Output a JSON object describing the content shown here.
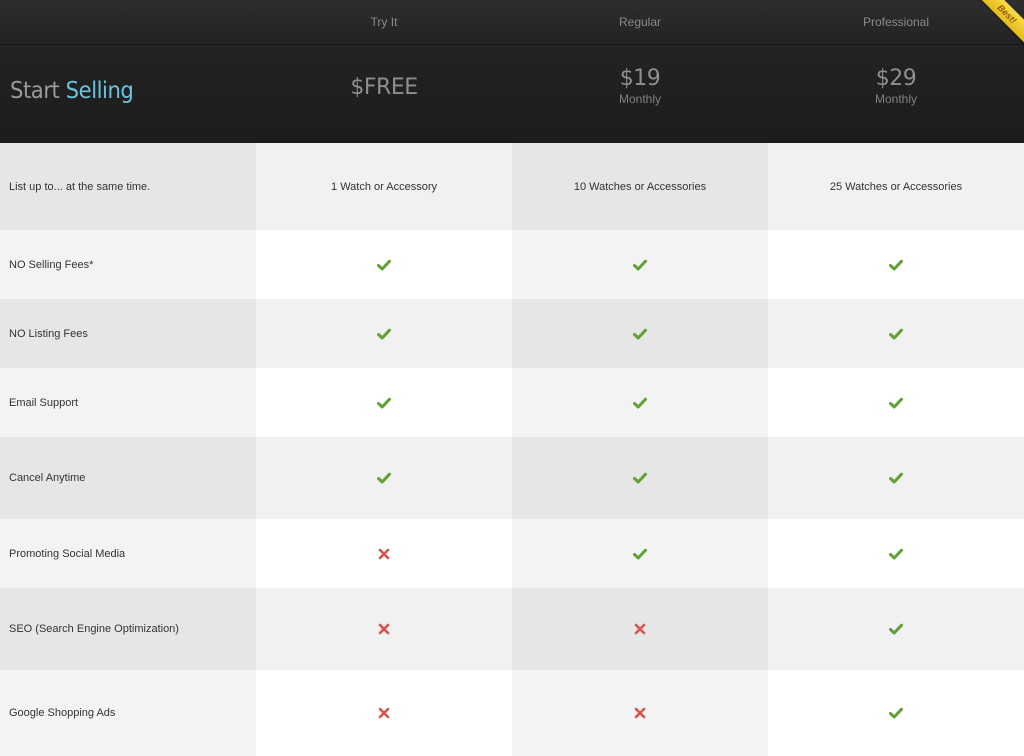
{
  "header": {
    "title_part1": "Start",
    "title_part2": "Selling",
    "ribbon": "Best!",
    "plans": [
      {
        "tier": "Try It",
        "price": "$FREE",
        "period": ""
      },
      {
        "tier": "Regular",
        "price": "$19",
        "period": "Monthly"
      },
      {
        "tier": "Professional",
        "price": "$29",
        "period": "Monthly"
      }
    ]
  },
  "colors": {
    "check": "#5fa336",
    "cross": "#d9534f",
    "accent": "#6cc1de"
  },
  "rows": [
    {
      "label": "List up to... at the same time.",
      "values": [
        "1 Watch or Accessory",
        "10 Watches or Accessories",
        "25 Watches or Accessories"
      ]
    },
    {
      "label": "NO Selling Fees*",
      "values": [
        "check-icon",
        "check-icon",
        "check-icon"
      ]
    },
    {
      "label": "NO Listing Fees",
      "values": [
        "check-icon",
        "check-icon",
        "check-icon"
      ]
    },
    {
      "label": "Email Support",
      "values": [
        "check-icon",
        "check-icon",
        "check-icon"
      ]
    },
    {
      "label": "Cancel Anytime",
      "values": [
        "check-icon",
        "check-icon",
        "check-icon"
      ]
    },
    {
      "label": "Promoting Social Media",
      "values": [
        "cross-icon",
        "check-icon",
        "check-icon"
      ]
    },
    {
      "label": "SEO (Search Engine Optimization)",
      "values": [
        "cross-icon",
        "cross-icon",
        "check-icon"
      ]
    },
    {
      "label": "Google Shopping Ads",
      "values": [
        "cross-icon",
        "cross-icon",
        "check-icon"
      ]
    }
  ]
}
